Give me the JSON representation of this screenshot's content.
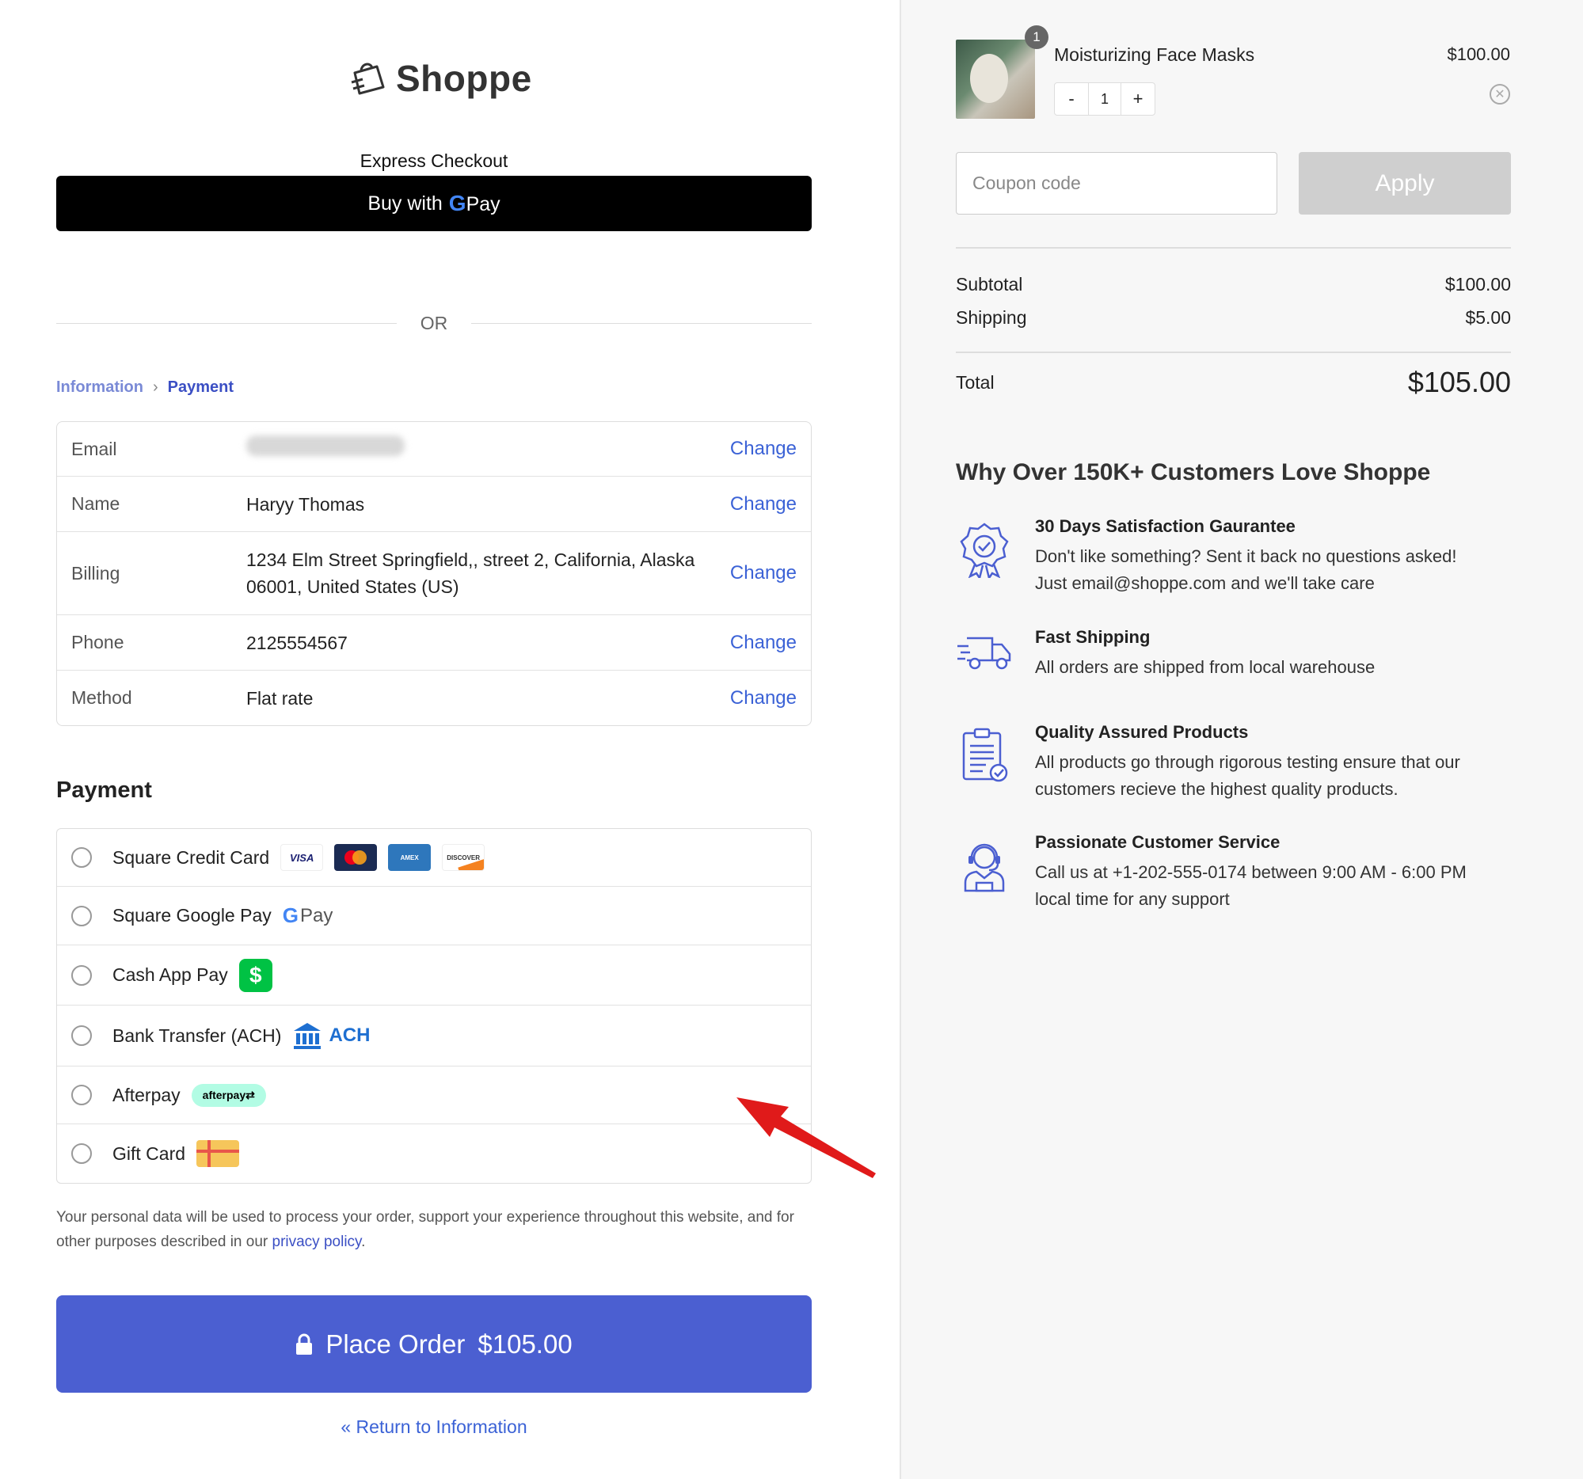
{
  "brand": {
    "name": "Shoppe"
  },
  "express": {
    "label": "Express Checkout",
    "button_prefix": "Buy with",
    "button_g": "G",
    "button_pay": "Pay"
  },
  "divider": {
    "or": "OR"
  },
  "breadcrumb": {
    "step1": "Information",
    "step2": "Payment"
  },
  "info": {
    "change_label": "Change",
    "rows": [
      {
        "key": "Email",
        "value": ""
      },
      {
        "key": "Name",
        "value": "Haryy Thomas"
      },
      {
        "key": "Billing",
        "value_line1": "1234 Elm Street Springfield,, street 2, California, Alaska",
        "value_line2": "06001, United States (US)"
      },
      {
        "key": "Phone",
        "value": "2125554567"
      },
      {
        "key": "Method",
        "value": "Flat rate"
      }
    ]
  },
  "payment": {
    "title": "Payment",
    "methods": [
      {
        "label": "Square Credit Card",
        "cards": [
          "VISA",
          "MasterCard",
          "AMERICAN EXPRESS",
          "DISCOVER"
        ]
      },
      {
        "label": "Square Google Pay",
        "badge_g": "G",
        "badge_pay": "Pay"
      },
      {
        "label": "Cash App Pay",
        "badge": "$"
      },
      {
        "label": "Bank Transfer (ACH)",
        "badge": "ACH"
      },
      {
        "label": "Afterpay",
        "badge": "afterpay⇄"
      },
      {
        "label": "Gift Card"
      }
    ]
  },
  "privacy": {
    "text": "Your personal data will be used to process your order, support your experience throughout this website, and for other purposes described in our ",
    "link": "privacy policy",
    "end": "."
  },
  "place_order": {
    "label": "Place Order",
    "amount": "$105.00"
  },
  "return_link": "« Return to Information",
  "cart": {
    "item": {
      "name": "Moisturizing Face Masks",
      "price": "$100.00",
      "qty": "1",
      "badge": "1",
      "minus": "-",
      "plus": "+"
    },
    "coupon_placeholder": "Coupon code",
    "apply_label": "Apply",
    "subtotal_label": "Subtotal",
    "subtotal": "$100.00",
    "shipping_label": "Shipping",
    "shipping": "$5.00",
    "total_label": "Total",
    "total": "$105.00"
  },
  "why": {
    "title": "Why Over 150K+ Customers Love Shoppe",
    "features": [
      {
        "icon": "badge-check-icon",
        "title": "30 Days Satisfaction Gaurantee",
        "line1": "Don't like something? Sent it back no questions asked!",
        "line2": "Just email@shoppe.com and we'll take care"
      },
      {
        "icon": "truck-icon",
        "title": "Fast Shipping",
        "line1": "All orders are shipped from local warehouse"
      },
      {
        "icon": "clipboard-check-icon",
        "title": "Quality Assured Products",
        "line1": "All products go through rigorous testing ensure that our",
        "line2": "customers recieve the highest quality products."
      },
      {
        "icon": "headset-agent-icon",
        "title": "Passionate Customer Service",
        "line1": "Call us at +1-202-555-0174 between 9:00 AM - 6:00 PM",
        "line2": "local time for any support"
      }
    ]
  },
  "colors": {
    "accent": "#4b5fd1",
    "link": "#3b62d6",
    "apply_disabled": "#cfcfcf",
    "arrow": "#e01a1a"
  }
}
